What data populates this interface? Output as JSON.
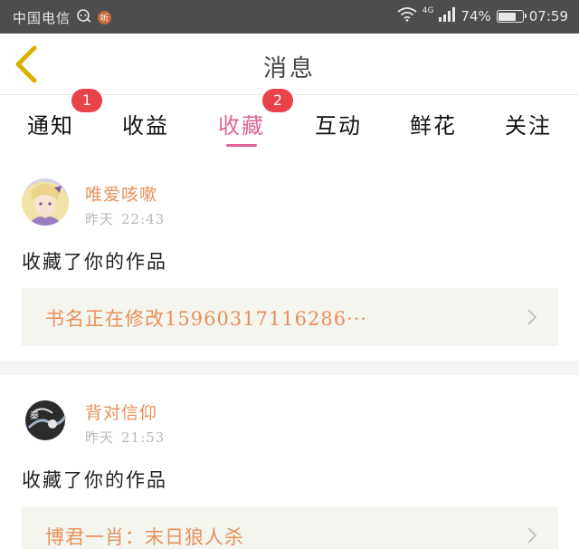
{
  "status_bar": {
    "carrier": "中国电信",
    "badge": "听",
    "network": "4G",
    "battery": "74%",
    "battery_level": 0.74,
    "time": "07:59"
  },
  "header": {
    "title": "消息"
  },
  "tabs": [
    {
      "label": "通知",
      "badge": "1",
      "active": false
    },
    {
      "label": "收益",
      "badge": "",
      "active": false
    },
    {
      "label": "收藏",
      "badge": "2",
      "active": true
    },
    {
      "label": "互动",
      "badge": "",
      "active": false
    },
    {
      "label": "鲜花",
      "badge": "",
      "active": false
    },
    {
      "label": "关注",
      "badge": "",
      "active": false
    }
  ],
  "items": [
    {
      "user": "唯爱咳嗽",
      "day": "昨天",
      "time": "22:43",
      "action": "收藏了你的作品",
      "work": "书名正在修改15960317116286···"
    },
    {
      "user": "背对信仰",
      "day": "昨天",
      "time": "21:53",
      "action": "收藏了你的作品",
      "work": "博君一肖：末日狼人杀"
    }
  ],
  "colors": {
    "accent": "#e0649a",
    "name": "#e8905a",
    "badge": "#e8424b",
    "back_arrow": "#d9b100"
  }
}
